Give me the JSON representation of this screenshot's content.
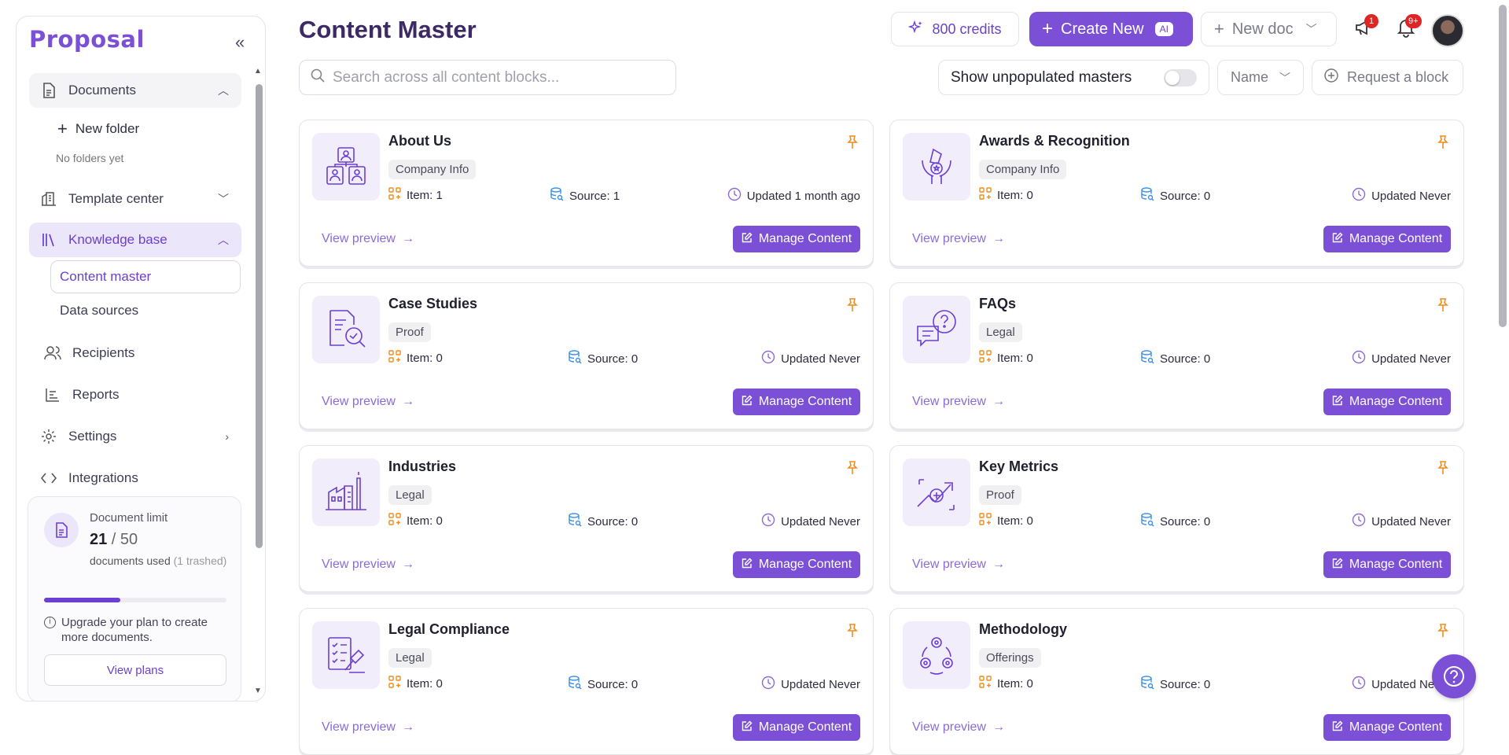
{
  "app": {
    "logo": "Proposal"
  },
  "sidebar": {
    "documents": "Documents",
    "new_folder": "New folder",
    "no_folders": "No folders yet",
    "template_center": "Template center",
    "knowledge_base": "Knowledge base",
    "content_master": "Content master",
    "data_sources": "Data sources",
    "recipients": "Recipients",
    "reports": "Reports",
    "settings": "Settings",
    "integrations": "Integrations",
    "limit": {
      "title": "Document limit",
      "used": "21",
      "separator": " / ",
      "max": "50",
      "used_text": "documents used ",
      "trashed_text": "(1 trashed)",
      "progress": 0.42,
      "upgrade_text": "Upgrade your plan to create more documents.",
      "view_plans": "View plans"
    }
  },
  "header": {
    "title": "Content Master",
    "credits": "800 credits",
    "create_new": "Create New",
    "ai_badge": "AI",
    "new_doc": "New doc",
    "announce_badge": "1",
    "bell_badge": "9+"
  },
  "toolbar": {
    "search_placeholder": "Search across all content blocks...",
    "show_unpopulated": "Show unpopulated masters",
    "sort": "Name",
    "request_block": "Request a block"
  },
  "card_labels": {
    "view_preview": "View preview",
    "manage_content": "Manage Content"
  },
  "cards": [
    {
      "title": "About Us",
      "tag": "Company Info",
      "item": "Item: 1",
      "source": "Source: 1",
      "updated": "Updated 1 month ago",
      "icon": "team-icon"
    },
    {
      "title": "Awards & Recognition",
      "tag": "Company Info",
      "item": "Item: 0",
      "source": "Source: 0",
      "updated": "Updated Never",
      "icon": "award-icon"
    },
    {
      "title": "Case Studies",
      "tag": "Proof",
      "item": "Item: 0",
      "source": "Source: 0",
      "updated": "Updated Never",
      "icon": "document-search-icon"
    },
    {
      "title": "FAQs",
      "tag": "Legal",
      "item": "Item: 0",
      "source": "Source: 0",
      "updated": "Updated Never",
      "icon": "chat-question-icon"
    },
    {
      "title": "Industries",
      "tag": "Legal",
      "item": "Item: 0",
      "source": "Source: 0",
      "updated": "Updated Never",
      "icon": "factory-icon"
    },
    {
      "title": "Key Metrics",
      "tag": "Proof",
      "item": "Item: 0",
      "source": "Source: 0",
      "updated": "Updated Never",
      "icon": "growth-icon"
    },
    {
      "title": "Legal Compliance",
      "tag": "Legal",
      "item": "Item: 0",
      "source": "Source: 0",
      "updated": "Updated Never",
      "icon": "legal-checklist-icon"
    },
    {
      "title": "Methodology",
      "tag": "Offerings",
      "item": "Item: 0",
      "source": "Source: 0",
      "updated": "Updated Never",
      "icon": "gears-cycle-icon"
    }
  ],
  "colors": {
    "accent": "#7b4fd6",
    "pin": "#f08c1c",
    "source_icon": "#3b8ee8",
    "badge": "#e02424"
  }
}
